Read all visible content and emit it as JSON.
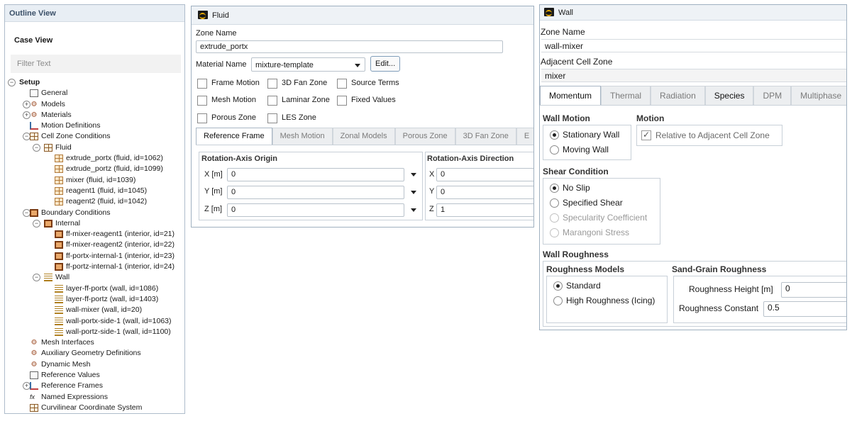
{
  "outline": {
    "title": "Outline View",
    "case_view": "Case View",
    "filter_placeholder": "Filter Text",
    "tree": [
      {
        "label": "Setup",
        "toggle": "−",
        "icon": "none",
        "bold": true,
        "level": 0
      },
      {
        "label": "General",
        "toggle": "",
        "icon": "doc",
        "level": 1
      },
      {
        "label": "Models",
        "toggle": "+",
        "icon": "misc",
        "level": 1
      },
      {
        "label": "Materials",
        "toggle": "+",
        "icon": "misc",
        "level": 1
      },
      {
        "label": "Motion Definitions",
        "toggle": "",
        "icon": "axes",
        "level": 1
      },
      {
        "label": "Cell Zone Conditions",
        "toggle": "−",
        "icon": "grid",
        "level": 1
      },
      {
        "label": "Fluid",
        "toggle": "−",
        "icon": "grid",
        "level": 2
      },
      {
        "label": "extrude_portx (fluid, id=1062)",
        "toggle": "",
        "icon": "cell",
        "level": 3
      },
      {
        "label": "extrude_portz (fluid, id=1099)",
        "toggle": "",
        "icon": "cell",
        "level": 3
      },
      {
        "label": "mixer (fluid, id=1039)",
        "toggle": "",
        "icon": "cell",
        "level": 3
      },
      {
        "label": "reagent1 (fluid, id=1045)",
        "toggle": "",
        "icon": "cell",
        "level": 3
      },
      {
        "label": "reagent2 (fluid, id=1042)",
        "toggle": "",
        "icon": "cell",
        "level": 3
      },
      {
        "label": "Boundary Conditions",
        "toggle": "−",
        "icon": "face",
        "level": 1
      },
      {
        "label": "Internal",
        "toggle": "−",
        "icon": "face",
        "level": 2
      },
      {
        "label": "ff-mixer-reagent1 (interior, id=21)",
        "toggle": "",
        "icon": "face",
        "level": 3
      },
      {
        "label": "ff-mixer-reagent2 (interior, id=22)",
        "toggle": "",
        "icon": "face",
        "level": 3
      },
      {
        "label": "ff-portx-internal-1 (interior, id=23)",
        "toggle": "",
        "icon": "face",
        "level": 3
      },
      {
        "label": "ff-portz-internal-1 (interior, id=24)",
        "toggle": "",
        "icon": "face",
        "level": 3
      },
      {
        "label": "Wall",
        "toggle": "−",
        "icon": "wall",
        "level": 2
      },
      {
        "label": "layer-ff-portx (wall, id=1086)",
        "toggle": "",
        "icon": "wall",
        "level": 3
      },
      {
        "label": "layer-ff-portz (wall, id=1403)",
        "toggle": "",
        "icon": "wall",
        "level": 3
      },
      {
        "label": "wall-mixer (wall, id=20)",
        "toggle": "",
        "icon": "wall",
        "level": 3
      },
      {
        "label": "wall-portx-side-1 (wall, id=1063)",
        "toggle": "",
        "icon": "wall",
        "level": 3
      },
      {
        "label": "wall-portz-side-1 (wall, id=1100)",
        "toggle": "",
        "icon": "wall",
        "level": 3
      },
      {
        "label": "Mesh Interfaces",
        "toggle": "",
        "icon": "misc",
        "level": 1
      },
      {
        "label": "Auxiliary Geometry Definitions",
        "toggle": "",
        "icon": "misc",
        "level": 1
      },
      {
        "label": "Dynamic Mesh",
        "toggle": "",
        "icon": "misc",
        "level": 1
      },
      {
        "label": "Reference Values",
        "toggle": "",
        "icon": "doc",
        "level": 1
      },
      {
        "label": "Reference Frames",
        "toggle": "+",
        "icon": "axes",
        "level": 1
      },
      {
        "label": "Named Expressions",
        "toggle": "",
        "icon": "fx",
        "level": 1
      },
      {
        "label": "Curvilinear Coordinate System",
        "toggle": "",
        "icon": "grid",
        "level": 1
      }
    ]
  },
  "fluid": {
    "title": "Fluid",
    "zone_name_label": "Zone Name",
    "zone_name": "extrude_portx",
    "material_name_label": "Material Name",
    "material_name": "mixture-template",
    "edit_label": "Edit...",
    "options": [
      {
        "label": "Frame Motion",
        "checked": false
      },
      {
        "label": "3D Fan Zone",
        "checked": false
      },
      {
        "label": "Source Terms",
        "checked": false
      },
      {
        "label": "Mesh Motion",
        "checked": false
      },
      {
        "label": "Laminar Zone",
        "checked": false
      },
      {
        "label": "Fixed Values",
        "checked": false
      },
      {
        "label": "Porous Zone",
        "checked": false
      },
      {
        "label": "LES Zone",
        "checked": false
      }
    ],
    "tabs": [
      "Reference Frame",
      "Mesh Motion",
      "Zonal Models",
      "Porous Zone",
      "3D Fan Zone",
      "E"
    ],
    "origin_title": "Rotation-Axis Origin",
    "direction_title": "Rotation-Axis Direction",
    "origin": [
      {
        "label": "X [m]",
        "value": "0"
      },
      {
        "label": "Y [m]",
        "value": "0"
      },
      {
        "label": "Z [m]",
        "value": "0"
      }
    ],
    "direction": [
      {
        "label": "X",
        "value": "0"
      },
      {
        "label": "Y",
        "value": "0"
      },
      {
        "label": "Z",
        "value": "1"
      }
    ]
  },
  "wall": {
    "title": "Wall",
    "zone_name_label": "Zone Name",
    "zone_name": "wall-mixer",
    "adjacent_label": "Adjacent Cell Zone",
    "adjacent": "mixer",
    "tabs": [
      "Momentum",
      "Thermal",
      "Radiation",
      "Species",
      "DPM",
      "Multiphase"
    ],
    "wall_motion_title": "Wall Motion",
    "wall_motion": [
      {
        "label": "Stationary Wall",
        "on": true
      },
      {
        "label": "Moving Wall",
        "on": false
      }
    ],
    "motion_title": "Motion",
    "relative_label": "Relative to Adjacent Cell Zone",
    "shear_title": "Shear Condition",
    "shear": [
      {
        "label": "No Slip",
        "on": true,
        "disabled": false
      },
      {
        "label": "Specified Shear",
        "on": false,
        "disabled": false
      },
      {
        "label": "Specularity Coefficient",
        "on": false,
        "disabled": true
      },
      {
        "label": "Marangoni Stress",
        "on": false,
        "disabled": true
      }
    ],
    "roughness_title": "Wall Roughness",
    "roughness_models_title": "Roughness Models",
    "roughness_models": [
      {
        "label": "Standard",
        "on": true
      },
      {
        "label": "High Roughness (Icing)",
        "on": false
      }
    ],
    "sand_grain_title": "Sand-Grain Roughness",
    "roughness_height_label": "Roughness Height [m]",
    "roughness_height": "0",
    "roughness_constant_label": "Roughness Constant",
    "roughness_constant": "0.5"
  }
}
